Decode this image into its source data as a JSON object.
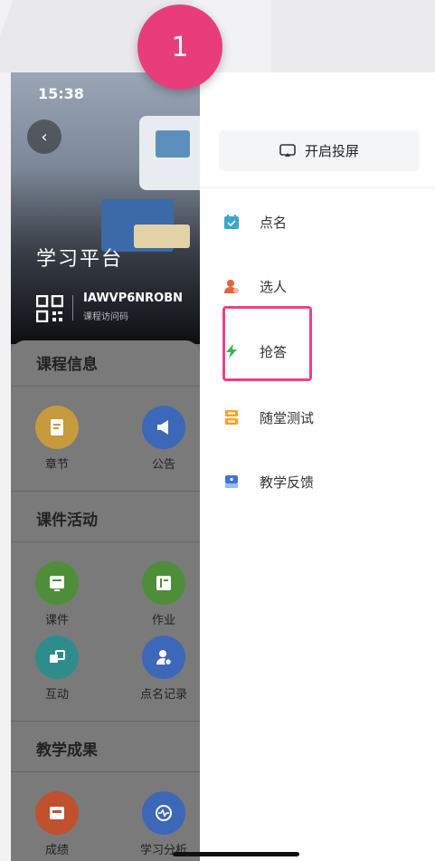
{
  "step_badge": "1",
  "status_bar": {
    "time": "15:38"
  },
  "course": {
    "title": "学习平台",
    "code": "IAWVP6NROBN",
    "code_label": "课程访问码"
  },
  "sections": [
    {
      "title": "课程信息",
      "items": [
        {
          "label": "章节",
          "icon": "chapter-icon",
          "color": "#c79a3e"
        },
        {
          "label": "公告",
          "icon": "announcement-icon",
          "color": "#3d67b8"
        }
      ]
    },
    {
      "title": "课件活动",
      "items": [
        {
          "label": "课件",
          "icon": "courseware-icon",
          "color": "#4f8e38"
        },
        {
          "label": "作业",
          "icon": "homework-icon",
          "color": "#4f8e38"
        },
        {
          "label": "互动",
          "icon": "interaction-icon",
          "color": "#2f8c8c"
        },
        {
          "label": "点名记录",
          "icon": "rollcall-record-icon",
          "color": "#3d67b8"
        }
      ]
    },
    {
      "title": "教学成果",
      "items": [
        {
          "label": "成绩",
          "icon": "score-icon",
          "color": "#c0502e"
        },
        {
          "label": "学习分析",
          "icon": "analysis-icon",
          "color": "#3d67b8"
        }
      ]
    }
  ],
  "drawer": {
    "screen_cast_label": "开启投屏",
    "menu": [
      {
        "label": "点名",
        "icon": "rollcall-icon",
        "color": "#3aa6c9"
      },
      {
        "label": "选人",
        "icon": "pick-person-icon",
        "color": "#e8623e"
      },
      {
        "label": "抢答",
        "icon": "quick-answer-icon",
        "color": "#3fb34f"
      },
      {
        "label": "随堂测试",
        "icon": "quiz-icon",
        "color": "#f2a523"
      },
      {
        "label": "教学反馈",
        "icon": "feedback-icon",
        "color": "#3b74d6"
      }
    ]
  },
  "colors": {
    "highlight": "#ec3f8a",
    "badge": "#e93d7b"
  }
}
